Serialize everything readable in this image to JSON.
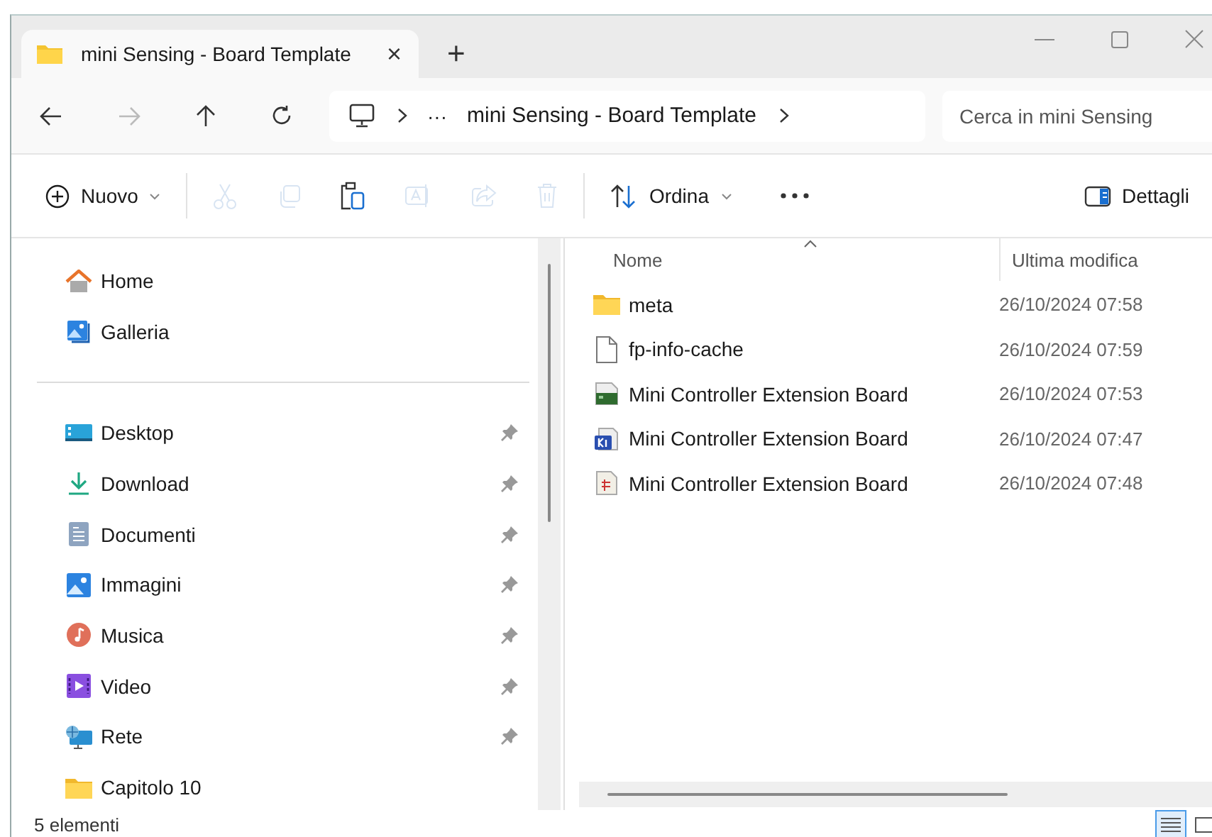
{
  "tabs": [
    {
      "label": "mini Sensing - Board Template",
      "selected": true,
      "close": "×"
    }
  ],
  "new_tab": "+",
  "address_bar": {
    "overflow": "···",
    "crumbs": [
      "mini Sensing - Board Template"
    ],
    "search": {
      "placeholder": "Cerca in mini Sensing"
    }
  },
  "toolbar": [
    {
      "kind": "new",
      "label": "Nuovo",
      "disabled": false
    },
    {
      "kind": "cut",
      "disabled": true
    },
    {
      "kind": "copy",
      "disabled": true
    },
    {
      "kind": "paste",
      "disabled": false
    },
    {
      "kind": "rename",
      "disabled": true
    },
    {
      "kind": "share",
      "disabled": true
    },
    {
      "kind": "delete",
      "disabled": true
    },
    {
      "kind": "sort",
      "label": "Ordina",
      "disabled": false
    },
    {
      "kind": "more",
      "disabled": false
    },
    {
      "kind": "details",
      "label": "Dettagli",
      "disabled": false
    }
  ],
  "sidebar": {
    "groups": [
      [
        {
          "label": "Home",
          "kind": "home",
          "pinned": false
        },
        {
          "label": "Galleria",
          "kind": "gallery",
          "pinned": false
        }
      ],
      [
        {
          "label": "Desktop",
          "kind": "desktop",
          "pinned": true
        },
        {
          "label": "Download",
          "kind": "download",
          "pinned": true
        },
        {
          "label": "Documenti",
          "kind": "documents",
          "pinned": true
        },
        {
          "label": "Immagini",
          "kind": "pictures",
          "pinned": true
        },
        {
          "label": "Musica",
          "kind": "music",
          "pinned": true
        },
        {
          "label": "Video",
          "kind": "video",
          "pinned": true
        },
        {
          "label": "Rete",
          "kind": "network",
          "pinned": true
        },
        {
          "label": "Capitolo 10",
          "kind": "folder",
          "pinned": false
        }
      ]
    ]
  },
  "table": {
    "columns": [
      "Nome",
      "Ultima modifica"
    ],
    "rows": [
      {
        "name": "meta",
        "modified": "26/10/2024 07:58",
        "kind": "folder"
      },
      {
        "name": "fp-info-cache",
        "modified": "26/10/2024 07:59",
        "kind": "file"
      },
      {
        "name": "Mini Controller Extension Board",
        "modified": "26/10/2024 07:53",
        "kind": "board"
      },
      {
        "name": "Mini Controller Extension Board",
        "modified": "26/10/2024 07:47",
        "kind": "project"
      },
      {
        "name": "Mini Controller Extension Board",
        "modified": "26/10/2024 07:48",
        "kind": "schematic"
      }
    ]
  },
  "status_bar": {
    "count": "5 elementi",
    "views": [
      {
        "kind": "details",
        "selected": true
      },
      {
        "kind": "tiles",
        "selected": false
      }
    ]
  }
}
